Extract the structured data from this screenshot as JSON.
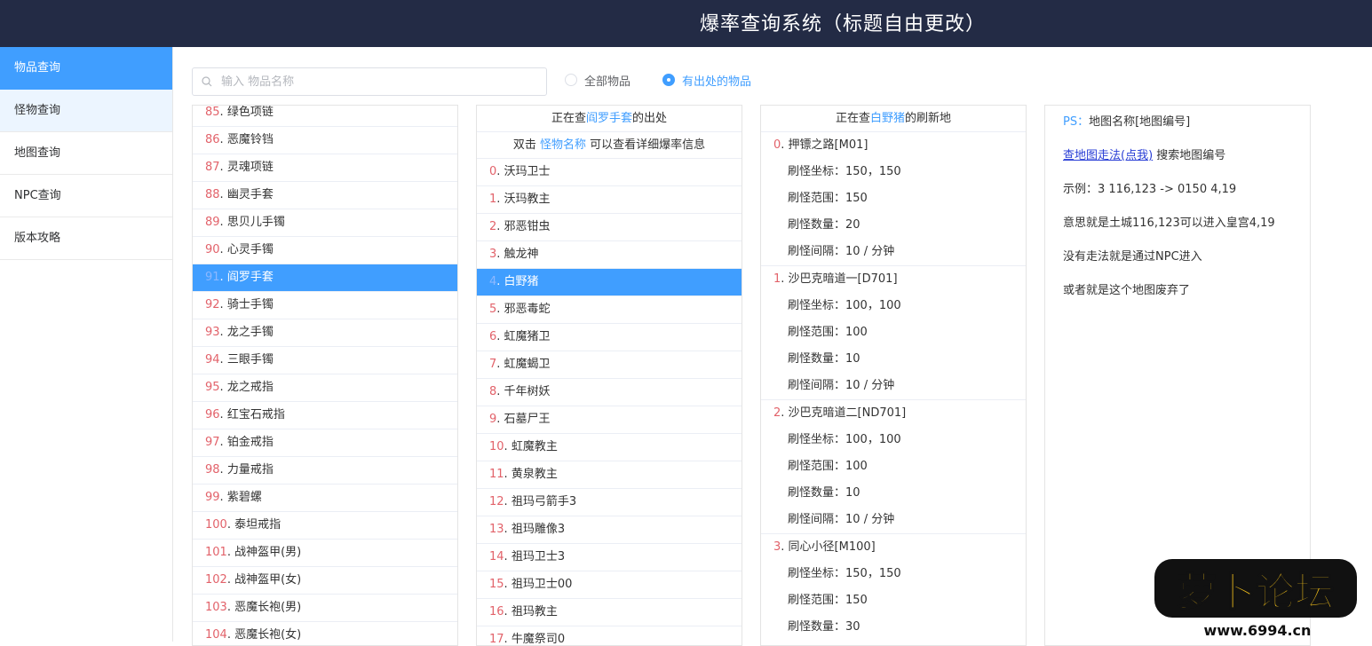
{
  "header": {
    "title": "爆率查询系统（标题自由更改）"
  },
  "sidebar": {
    "items": [
      {
        "label": "物品查询"
      },
      {
        "label": "怪物查询"
      },
      {
        "label": "地图查询"
      },
      {
        "label": "NPC查询"
      },
      {
        "label": "版本攻略"
      }
    ]
  },
  "search": {
    "placeholder": "输入 物品名称",
    "value": ""
  },
  "filter": {
    "all_label": "全部物品",
    "drop_label": "有出处的物品",
    "selected": "有出处的物品"
  },
  "items": [
    {
      "num": "85",
      "name": "绿色项链"
    },
    {
      "num": "86",
      "name": "恶魔铃铛"
    },
    {
      "num": "87",
      "name": "灵魂项链"
    },
    {
      "num": "88",
      "name": "幽灵手套"
    },
    {
      "num": "89",
      "name": "思贝儿手镯"
    },
    {
      "num": "90",
      "name": "心灵手镯"
    },
    {
      "num": "91",
      "name": "阎罗手套"
    },
    {
      "num": "92",
      "name": "骑士手镯"
    },
    {
      "num": "93",
      "name": "龙之手镯"
    },
    {
      "num": "94",
      "name": "三眼手镯"
    },
    {
      "num": "95",
      "name": "龙之戒指"
    },
    {
      "num": "96",
      "name": "红宝石戒指"
    },
    {
      "num": "97",
      "name": "铂金戒指"
    },
    {
      "num": "98",
      "name": "力量戒指"
    },
    {
      "num": "99",
      "name": "紫碧螺"
    },
    {
      "num": "100",
      "name": "泰坦戒指"
    },
    {
      "num": "101",
      "name": "战神盔甲(男)"
    },
    {
      "num": "102",
      "name": "战神盔甲(女)"
    },
    {
      "num": "103",
      "name": "恶魔长袍(男)"
    },
    {
      "num": "104",
      "name": "恶魔长袍(女)"
    }
  ],
  "monsters_panel": {
    "head_prefix": "正在查",
    "head_item": "阎罗手套",
    "head_suffix": "的出处",
    "tip_prefix": "双击",
    "tip_link": "怪物名称",
    "tip_suffix": "可以查看详细爆率信息",
    "rows": [
      {
        "num": "0",
        "name": "沃玛卫士"
      },
      {
        "num": "1",
        "name": "沃玛教主"
      },
      {
        "num": "2",
        "name": "邪恶钳虫"
      },
      {
        "num": "3",
        "name": "触龙神"
      },
      {
        "num": "4",
        "name": "白野猪"
      },
      {
        "num": "5",
        "name": "邪恶毒蛇"
      },
      {
        "num": "6",
        "name": "虹魔猪卫"
      },
      {
        "num": "7",
        "name": "虹魔蝎卫"
      },
      {
        "num": "8",
        "name": "千年树妖"
      },
      {
        "num": "9",
        "name": "石墓尸王"
      },
      {
        "num": "10",
        "name": "虹魔教主"
      },
      {
        "num": "11",
        "name": "黄泉教主"
      },
      {
        "num": "12",
        "name": "祖玛弓箭手3"
      },
      {
        "num": "13",
        "name": "祖玛雕像3"
      },
      {
        "num": "14",
        "name": "祖玛卫士3"
      },
      {
        "num": "15",
        "name": "祖玛卫士00"
      },
      {
        "num": "16",
        "name": "祖玛教主"
      },
      {
        "num": "17",
        "name": "牛魔祭司0"
      }
    ]
  },
  "maps_panel": {
    "head_prefix": "正在查",
    "head_monster": "白野猪",
    "head_suffix": "的刷新地",
    "labels": {
      "coord": "刷怪坐标：",
      "range": "刷怪范围：",
      "count": "刷怪数量：",
      "interval": "刷怪间隔："
    },
    "maps": [
      {
        "num": "0",
        "name": "押镖之路[M01]",
        "coord": "150，150",
        "range": "150",
        "count": "20",
        "interval": "10 / 分钟"
      },
      {
        "num": "1",
        "name": "沙巴克暗道一[D701]",
        "coord": "100，100",
        "range": "100",
        "count": "10",
        "interval": "10 / 分钟"
      },
      {
        "num": "2",
        "name": "沙巴克暗道二[ND701]",
        "coord": "100，100",
        "range": "100",
        "count": "10",
        "interval": "10 / 分钟"
      },
      {
        "num": "3",
        "name": "同心小径[M100]",
        "coord": "150，150",
        "range": "150",
        "count": "30",
        "interval": ""
      }
    ]
  },
  "info_panel": {
    "ps_label": "PS：",
    "ps_text": "地图名称[地图编号]",
    "link_a": "查地图走法",
    "link_b": "(点我)",
    "link_suffix": " 搜索地图编号",
    "example": "示例：3 116,123 -> 0150 4,19",
    "meaning": "意思就是土城116,123可以进入皇宫4,19",
    "no_route": "没有走法就是通过NPC进入",
    "abandoned": "或者就是这个地图废弃了"
  },
  "watermark": {
    "text": "萝卜论坛",
    "url": "www.6994.cn"
  },
  "colors": {
    "header": "#232b45",
    "accent": "#409eff",
    "number": "#e2626a"
  }
}
